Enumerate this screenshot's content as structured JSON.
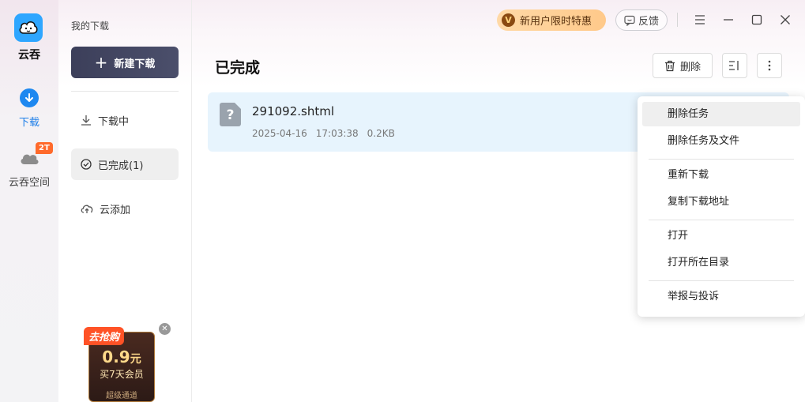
{
  "app": {
    "name": "云吞"
  },
  "rail": {
    "items": [
      {
        "label": "下载"
      },
      {
        "label": "云吞空间",
        "badge": "2T"
      }
    ]
  },
  "sidebar": {
    "title": "我的下载",
    "new_download": "新建下载",
    "items": [
      {
        "label": "下载中"
      },
      {
        "label": "已完成(1)"
      },
      {
        "label": "云添加"
      }
    ]
  },
  "ad": {
    "tag": "去抢购",
    "price": "0.9",
    "unit": "元",
    "subtitle": "买7天会员",
    "footer": "超级通道"
  },
  "titlebar": {
    "vip_label": "新用户限时特惠",
    "vip_icon_text": "V",
    "feedback_label": "反馈"
  },
  "main": {
    "title": "已完成",
    "delete_label": "删除"
  },
  "files": [
    {
      "name": "291092.shtml",
      "date": "2025-04-16",
      "time": "17:03:38",
      "size": "0.2KB"
    }
  ],
  "context_menu": {
    "items": [
      "删除任务",
      "删除任务及文件",
      "重新下载",
      "复制下载地址",
      "打开",
      "打开所在目录",
      "举报与投诉"
    ]
  },
  "colors": {
    "accent": "#1e88f0",
    "badge": "#ff6a2b",
    "row_selected": "#e7f4fd",
    "new_button": "#3c3f5a"
  }
}
